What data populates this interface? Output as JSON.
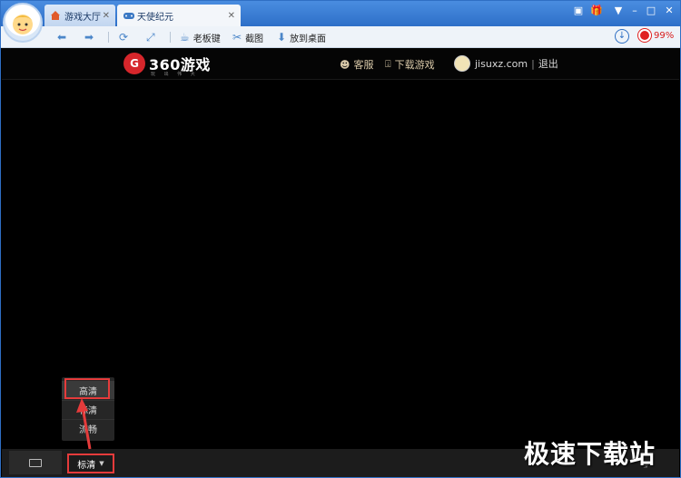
{
  "browser": {
    "tabs": [
      {
        "label": "游戏大厅",
        "icon": "home-icon"
      },
      {
        "label": "天使纪元",
        "icon": "gamepad-icon"
      }
    ],
    "toolbar": {
      "boss_key": "老板键",
      "screenshot": "截图",
      "desktop": "放到桌面"
    },
    "speed_percent": "99%"
  },
  "game_header": {
    "logo_text": "360游戏",
    "logo_mark": "G",
    "logo_subtitle": "玩 出 伟 大",
    "service_label": "客服",
    "download_label": "下载游戏",
    "username": "jisuxz.com",
    "logout_label": "退出"
  },
  "quality": {
    "current": "标清",
    "options": [
      "高清",
      "标清",
      "流畅"
    ]
  },
  "watermark": "极速下载站",
  "colors": {
    "highlight": "#e53b3b",
    "title_blue": "#2e6fc8",
    "accent_red": "#d6262b"
  }
}
